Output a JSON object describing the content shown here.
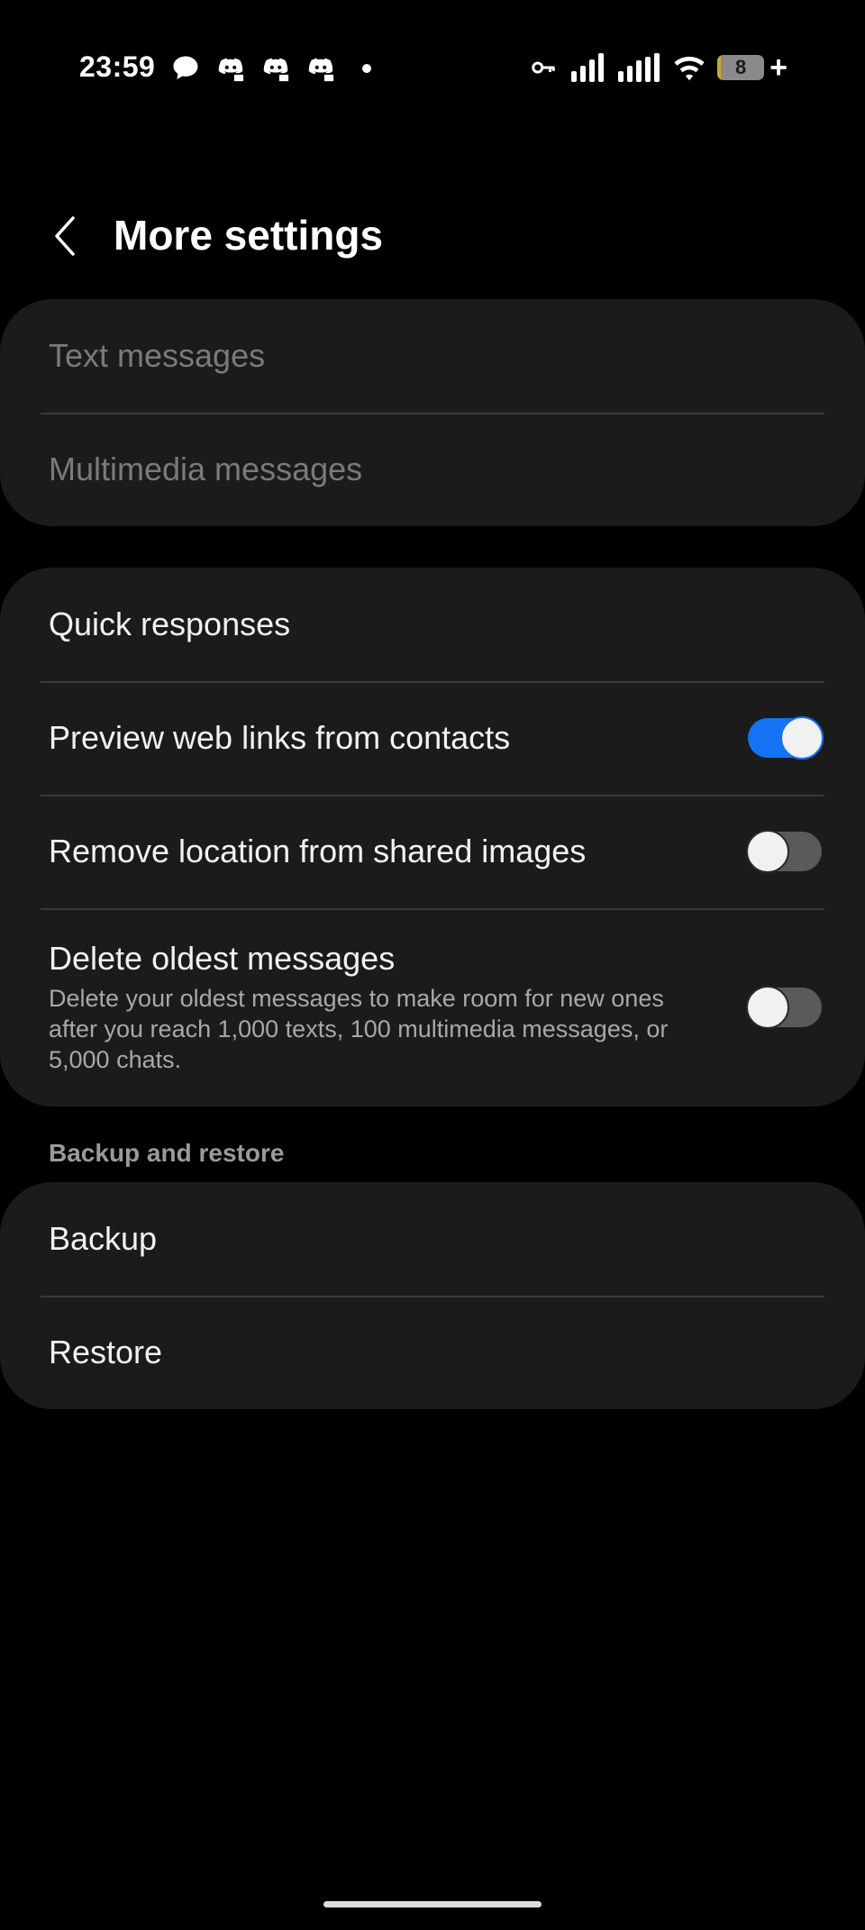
{
  "status_bar": {
    "time": "23:59",
    "battery_level": "8",
    "battery_fraction": 0.08,
    "icons": [
      "chat-bubble-icon",
      "discord-icon",
      "discord-icon",
      "discord-icon",
      "dot-icon",
      "vpn-key-icon",
      "signal-icon",
      "signal-icon",
      "wifi-icon",
      "battery-icon"
    ]
  },
  "header": {
    "title": "More settings"
  },
  "messages_card": {
    "items": [
      {
        "label": "Text messages",
        "enabled": false
      },
      {
        "label": "Multimedia messages",
        "enabled": false
      }
    ]
  },
  "options_card": {
    "items": [
      {
        "label": "Quick responses"
      },
      {
        "label": "Preview web links from contacts",
        "toggle": true
      },
      {
        "label": "Remove location from shared images",
        "toggle": false
      },
      {
        "label": "Delete oldest messages",
        "description": "Delete your oldest messages to make room for new ones after you reach 1,000 texts, 100 multimedia messages, or 5,000 chats.",
        "toggle": false
      }
    ]
  },
  "backup_section": {
    "header": "Backup and restore",
    "items": [
      {
        "label": "Backup"
      },
      {
        "label": "Restore"
      }
    ]
  },
  "colors": {
    "background": "#000000",
    "card": "#1b1b1b",
    "accent": "#1472f5",
    "battery_fill": "#c9a82e"
  }
}
